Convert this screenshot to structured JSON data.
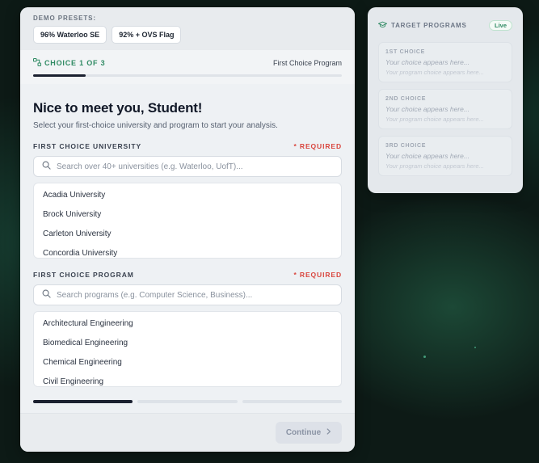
{
  "presets": {
    "label": "DEMO PRESETS:",
    "buttons": [
      "96% Waterloo SE",
      "92% + OVS Flag"
    ]
  },
  "step": {
    "indicator": "CHOICE 1 OF 3",
    "context": "First Choice Program",
    "progress_percent": 17
  },
  "main": {
    "title": "Nice to meet you, Student!",
    "subtitle": "Select your first-choice university and program to start your analysis.",
    "university": {
      "label": "FIRST CHOICE UNIVERSITY",
      "required": "* REQUIRED",
      "placeholder": "Search over 40+ universities (e.g. Waterloo, UofT)...",
      "items": [
        "Acadia University",
        "Brock University",
        "Carleton University",
        "Concordia University"
      ]
    },
    "program": {
      "label": "FIRST CHOICE PROGRAM",
      "required": "* REQUIRED",
      "placeholder": "Search programs (e.g. Computer Science, Business)...",
      "items": [
        "Architectural Engineering",
        "Biomedical Engineering",
        "Chemical Engineering",
        "Civil Engineering"
      ]
    },
    "segments_active": 1,
    "segments_total": 3
  },
  "footer": {
    "continue_label": "Continue"
  },
  "sidebar": {
    "title": "TARGET PROGRAMS",
    "badge": "Live",
    "choices": [
      {
        "label": "1ST CHOICE",
        "main": "Your choice appears here...",
        "sub": "Your program choice appears here..."
      },
      {
        "label": "2ND CHOICE",
        "main": "Your choice appears here...",
        "sub": "Your program choice appears here..."
      },
      {
        "label": "3RD CHOICE",
        "main": "Your choice appears here...",
        "sub": "Your program choice appears here..."
      }
    ]
  },
  "colors": {
    "accent_green": "#2f8a63",
    "required_red": "#d9463e",
    "dark": "#1b2130"
  }
}
